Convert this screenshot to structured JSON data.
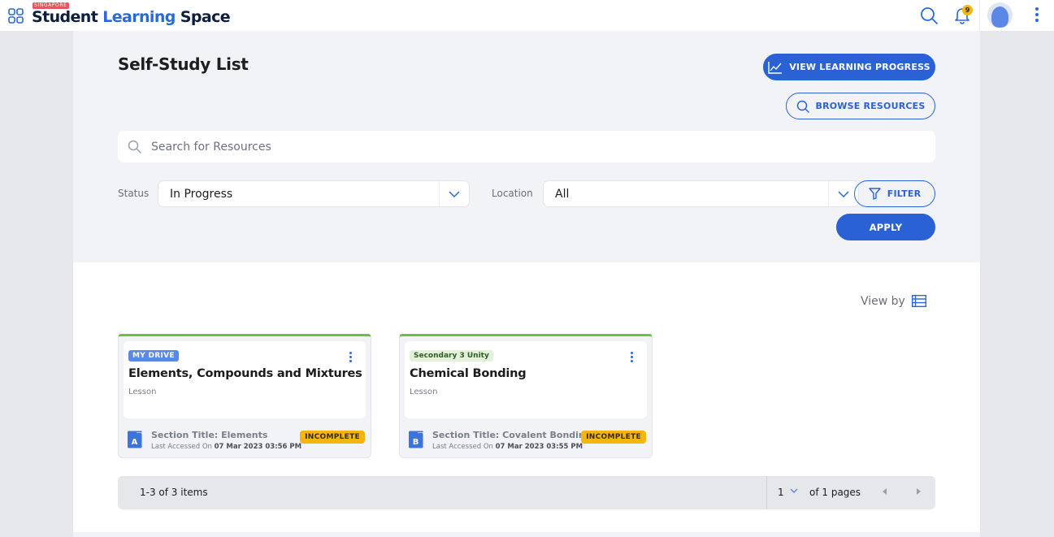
{
  "header": {
    "logo_tag": "SINGAPORE",
    "logo_part1": "Student",
    "logo_part2": "Learning",
    "logo_part3": "Space",
    "notification_count": "9",
    "icons": {
      "apps": "apps-grid-icon",
      "search": "search-icon",
      "notifications": "bell-icon",
      "avatar": "avatar",
      "more": "more-vertical-icon"
    }
  },
  "page": {
    "title": "Self-Study List",
    "view_progress_label": "VIEW LEARNING PROGRESS",
    "browse_resources_label": "BROWSE RESOURCES",
    "search_placeholder": "Search for Resources",
    "search_value": ""
  },
  "filters": {
    "status_label": "Status",
    "status_value": "In Progress",
    "location_label": "Location",
    "location_value": "All",
    "filter_label": "FILTER",
    "apply_label": "APPLY"
  },
  "view_by_label": "View by",
  "cards": [
    {
      "tag": "MY DRIVE",
      "tag_type": "drive",
      "title": "Elements, Compounds and Mixtures",
      "type": "Lesson",
      "section_letter": "A",
      "section_title": "Section Title: Elements",
      "last_accessed_label": "Last Accessed On",
      "last_accessed_value": "07 Mar 2023 03:56 PM",
      "status": "INCOMPLETE"
    },
    {
      "tag": "Secondary 3 Unity",
      "tag_type": "class",
      "title": "Chemical Bonding",
      "type": "Lesson",
      "section_letter": "B",
      "section_title": "Section Title: Covalent Bonding",
      "last_accessed_label": "Last Accessed On",
      "last_accessed_value": "07 Mar 2023 03:55 PM",
      "status": "INCOMPLETE"
    }
  ],
  "pagination": {
    "count_text": "1-3 of 3 items",
    "current_page": "1",
    "of_pages_text": "of 1 pages"
  },
  "colors": {
    "brand_blue": "#2a62d6",
    "card_accent_green": "#6cc04a",
    "incomplete_badge": "#f5b50c",
    "logo_tag_red": "#e2585e"
  }
}
